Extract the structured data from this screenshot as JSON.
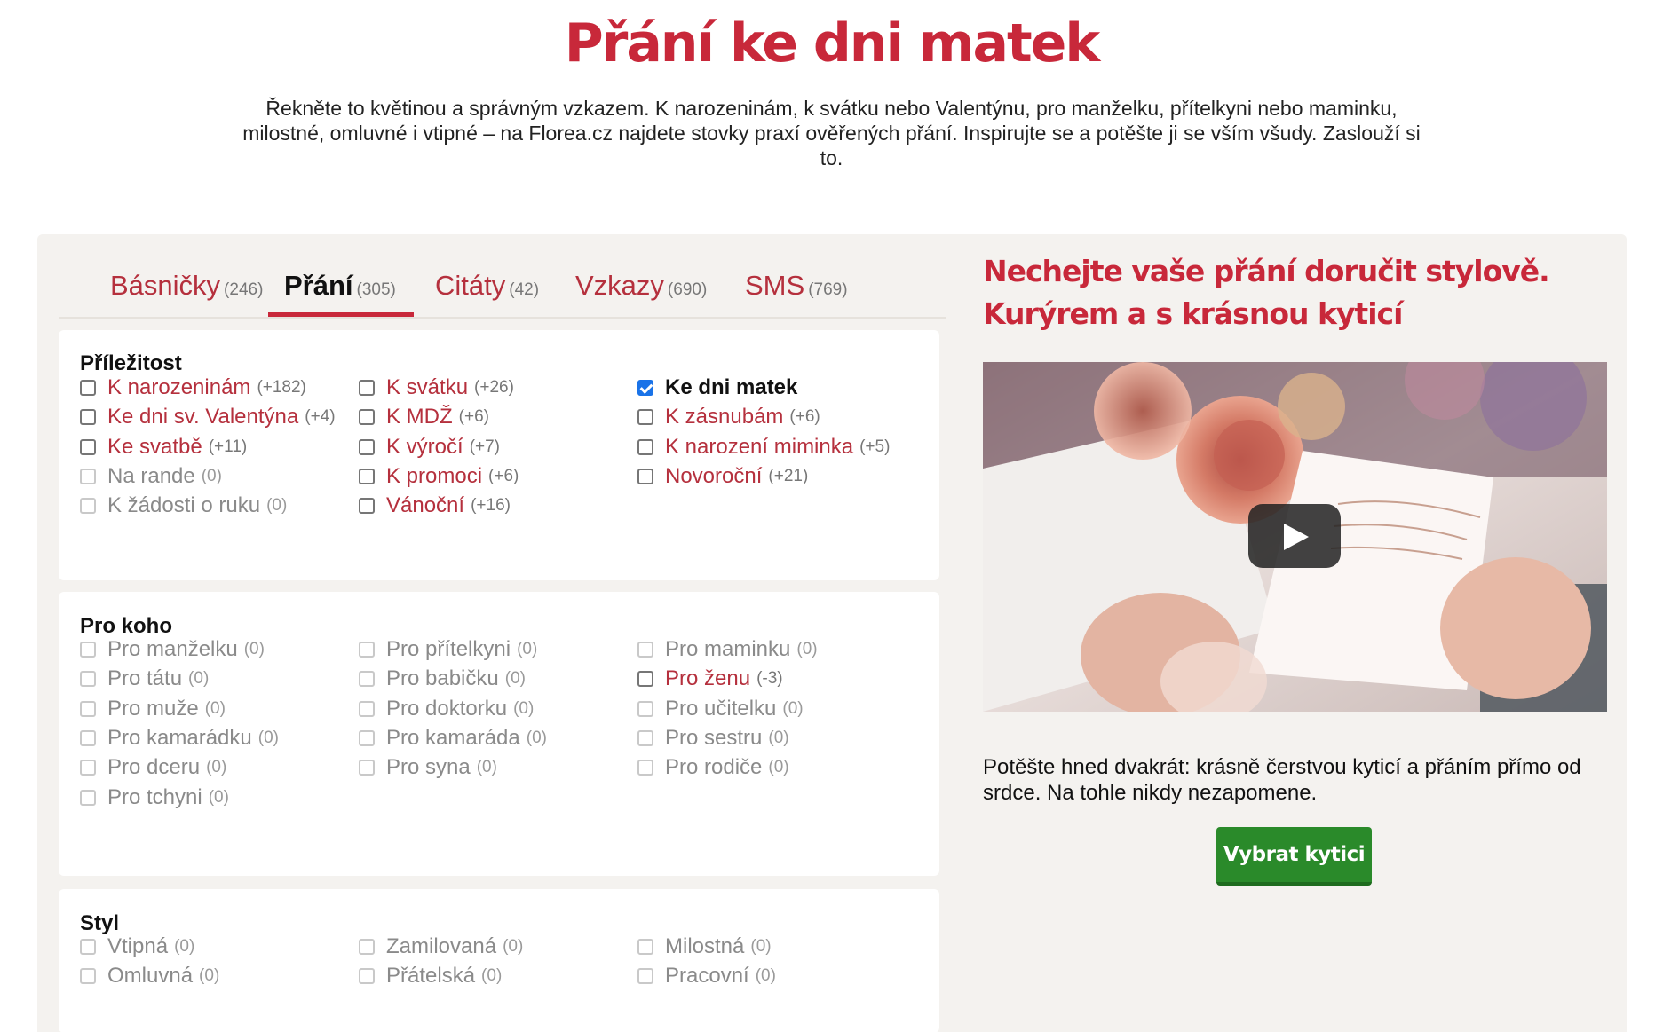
{
  "page": {
    "title": "Přání ke dni matek",
    "intro": "Řekněte to květinou a správným vzkazem. K narozeninám, k svátku nebo Valentýnu, pro manželku, přítelkyni nebo maminku, milostné, omluvné i vtipné – na Florea.cz najdete stovky praxí ověřených přání. Inspirujte se a potěšte ji se vším všudy. Zaslouží si to."
  },
  "tabs": [
    {
      "label": "Básničky",
      "count": "(246)",
      "active": false
    },
    {
      "label": "Přání",
      "count": "(305)",
      "active": true
    },
    {
      "label": "Citáty",
      "count": "(42)",
      "active": false
    },
    {
      "label": "Vzkazy",
      "count": "(690)",
      "active": false
    },
    {
      "label": "SMS",
      "count": "(769)",
      "active": false
    }
  ],
  "filters": {
    "occasion": {
      "title": "Příležitost",
      "options": [
        {
          "label": "K narozeninám",
          "count": "(+182)",
          "state": "enabled"
        },
        {
          "label": "K svátku",
          "count": "(+26)",
          "state": "enabled"
        },
        {
          "label": "Ke dni matek",
          "count": "",
          "state": "checked"
        },
        {
          "label": "Ke dni sv. Valentýna",
          "count": "(+4)",
          "state": "enabled"
        },
        {
          "label": "K MDŽ",
          "count": "(+6)",
          "state": "enabled"
        },
        {
          "label": "K zásnubám",
          "count": "(+6)",
          "state": "enabled"
        },
        {
          "label": "Ke svatbě",
          "count": "(+11)",
          "state": "enabled"
        },
        {
          "label": "K výročí",
          "count": "(+7)",
          "state": "enabled"
        },
        {
          "label": "K narození miminka",
          "count": "(+5)",
          "state": "enabled"
        },
        {
          "label": "Na rande",
          "count": "(0)",
          "state": "disabled"
        },
        {
          "label": "K promoci",
          "count": "(+6)",
          "state": "enabled"
        },
        {
          "label": "Novoroční",
          "count": "(+21)",
          "state": "enabled"
        },
        {
          "label": "K žádosti o ruku",
          "count": "(0)",
          "state": "disabled"
        },
        {
          "label": "Vánoční",
          "count": "(+16)",
          "state": "enabled"
        }
      ]
    },
    "recipient": {
      "title": "Pro koho",
      "options": [
        {
          "label": "Pro manželku",
          "count": "(0)",
          "state": "disabled"
        },
        {
          "label": "Pro přítelkyni",
          "count": "(0)",
          "state": "disabled"
        },
        {
          "label": "Pro maminku",
          "count": "(0)",
          "state": "disabled"
        },
        {
          "label": "Pro tátu",
          "count": "(0)",
          "state": "disabled"
        },
        {
          "label": "Pro babičku",
          "count": "(0)",
          "state": "disabled"
        },
        {
          "label": "Pro ženu",
          "count": "(-3)",
          "state": "enabled"
        },
        {
          "label": "Pro muže",
          "count": "(0)",
          "state": "disabled"
        },
        {
          "label": "Pro doktorku",
          "count": "(0)",
          "state": "disabled"
        },
        {
          "label": "Pro učitelku",
          "count": "(0)",
          "state": "disabled"
        },
        {
          "label": "Pro kamarádku",
          "count": "(0)",
          "state": "disabled"
        },
        {
          "label": "Pro kamaráda",
          "count": "(0)",
          "state": "disabled"
        },
        {
          "label": "Pro sestru",
          "count": "(0)",
          "state": "disabled"
        },
        {
          "label": "Pro dceru",
          "count": "(0)",
          "state": "disabled"
        },
        {
          "label": "Pro syna",
          "count": "(0)",
          "state": "disabled"
        },
        {
          "label": "Pro rodiče",
          "count": "(0)",
          "state": "disabled"
        },
        {
          "label": "Pro tchyni",
          "count": "(0)",
          "state": "disabled"
        }
      ]
    },
    "style": {
      "title": "Styl",
      "options": [
        {
          "label": "Vtipná",
          "count": "(0)",
          "state": "disabled"
        },
        {
          "label": "Zamilovaná",
          "count": "(0)",
          "state": "disabled"
        },
        {
          "label": "Milostná",
          "count": "(0)",
          "state": "disabled"
        },
        {
          "label": "Omluvná",
          "count": "(0)",
          "state": "disabled"
        },
        {
          "label": "Přátelská",
          "count": "(0)",
          "state": "disabled"
        },
        {
          "label": "Pracovní",
          "count": "(0)",
          "state": "disabled"
        }
      ]
    }
  },
  "promo": {
    "title": "Nechejte vaše přání doručit stylově. Kurýrem a s krásnou kyticí",
    "text": "Potěšte hned dvakrát: krásně čerstvou kyticí a přáním přímo od srdce. Na tohle nikdy nezapomene.",
    "button_label": "Vybrat kytici"
  },
  "colors": {
    "accent": "#c8283a",
    "link": "#b5303d",
    "panel_bg": "#f4f2ef",
    "cta": "#2a8a2a",
    "checkbox_checked": "#1a73e8"
  }
}
